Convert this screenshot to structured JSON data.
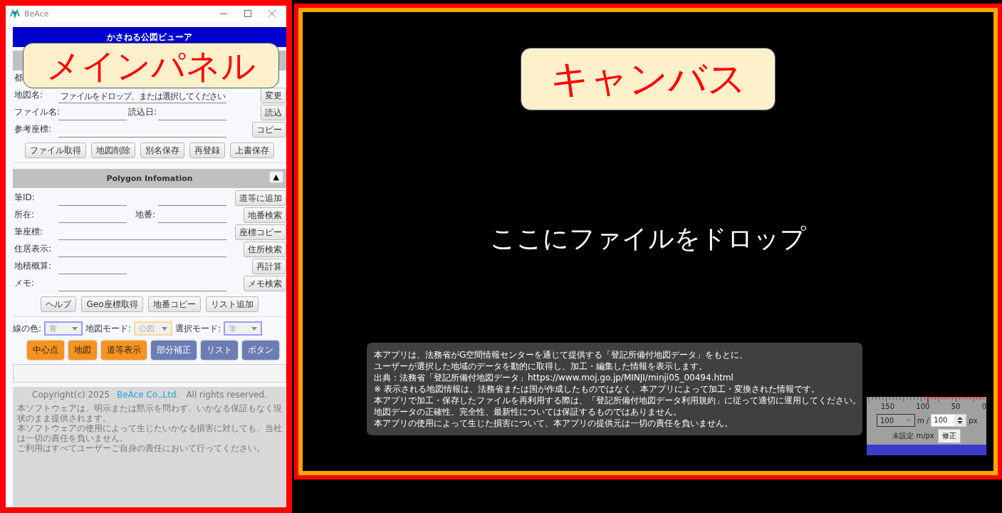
{
  "main_callout": "メインパネル",
  "window": {
    "title": "BeAce"
  },
  "app_header": "かさねる公図ビューア",
  "map_section": {
    "rows": [
      {
        "label": "都",
        "kind": "label_only"
      },
      {
        "label": "地図名:",
        "value": "ファイルをドロップ、または選択してください",
        "kind": "wide",
        "button": "変更"
      },
      {
        "label": "ファイル名:",
        "label2": "読込日:",
        "kind": "pair",
        "button": "読込"
      },
      {
        "label": "参考座標:",
        "kind": "wide",
        "button": "コピー"
      }
    ],
    "buttons": [
      "ファイル取得",
      "地図削除",
      "別名保存",
      "再登録",
      "上書保存"
    ]
  },
  "polygon_section": {
    "title": "Polygon Infomation",
    "toggle": "▲",
    "rows": [
      {
        "label": "筆ID:",
        "kind": "double",
        "button": "道等に追加"
      },
      {
        "label": "所在:",
        "label2": "地番:",
        "kind": "pair",
        "button": "地番検索"
      },
      {
        "label": "筆座標:",
        "kind": "wide",
        "button": "座標コピー"
      },
      {
        "label": "住居表示:",
        "kind": "wide",
        "button": "住所検索"
      },
      {
        "label": "地積概算:",
        "kind": "single",
        "button": "再計算"
      },
      {
        "label": "メモ:",
        "kind": "wide",
        "button": "メモ検索"
      }
    ],
    "buttons": [
      "ヘルプ",
      "Geo座標取得",
      "地番コピー",
      "リスト追加"
    ]
  },
  "selectors": [
    {
      "label": "線の色:",
      "value": "青",
      "color": "#9b9bff"
    },
    {
      "label": "地図モード:",
      "value": "公図",
      "color": "#f7d9a0"
    },
    {
      "label": "選択モード:",
      "value": "筆",
      "color": "#9b9bff"
    }
  ],
  "mode_buttons": [
    {
      "label": "中心点",
      "color": "#f7931e"
    },
    {
      "label": "地図",
      "color": "#f7931e"
    },
    {
      "label": "道等表示",
      "color": "#f7931e"
    },
    {
      "label": "部分補正",
      "color": "#6b7db3"
    },
    {
      "label": "リスト",
      "color": "#6b7db3"
    },
    {
      "label": "ボタン",
      "color": "#6b7db3"
    }
  ],
  "footer": {
    "copyright": "Copyright(c) 2025",
    "company_link": "BeAce Co.,Ltd.",
    "rights": "All rights reserved.",
    "disclaimer": [
      "本ソフトウェアは、明示または黙示を問わず、いかなる保証もなく現状のまま提供されます。",
      "本ソフトウェアの使用によって生じたいかなる損害に対しても、当社は一切の責任を負いません。",
      "ご利用はすべてユーザーご自身の責任において行ってください。"
    ]
  },
  "canvas": {
    "callout": "キャンバス",
    "drop_hint": "ここにファイルをドロップ",
    "notice": [
      "本アプリは、法務省がG空間情報センターを通じて提供する「登記所備付地図データ」をもとに、",
      "ユーザーが選択した地域のデータを動的に取得し、加工・編集した情報を表示します。",
      "出典：法務省「登記所備付地図データ」https://www.moj.go.jp/MINJI/minji05_00494.html",
      "※ 表示される地図情報は、法務省または国が作成したものではなく、本アプリによって加工・変換された情報です。",
      "本アプリで加工・保存したファイルを再利用する際は、「登記所備付地図データ利用規約」に従って適切に運用してください。",
      "地図データの正確性、完全性、最新性については保証するものではありません。",
      "本アプリの使用によって生じた損害について、本アプリの提供元は一切の責任を負いません。"
    ],
    "scale": {
      "tick_labels": [
        "150",
        "100",
        "50",
        "0"
      ],
      "meters": "100",
      "meters_unit": "m /",
      "pixels": "100",
      "pixels_unit": "px",
      "status": "未設定 m/px",
      "apply_button": "修正"
    }
  }
}
